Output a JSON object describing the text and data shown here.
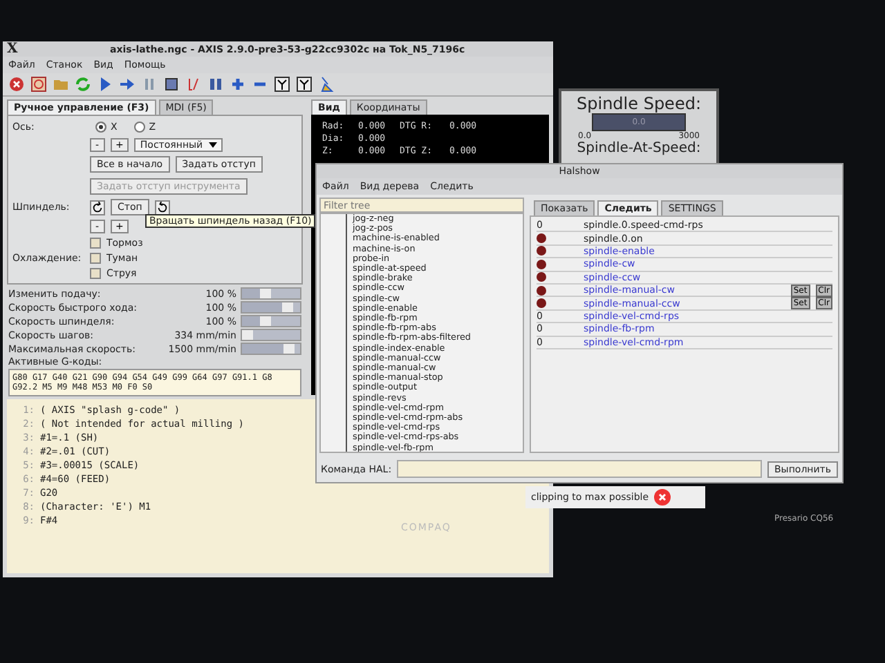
{
  "axis_window": {
    "logo": "X",
    "title": "axis-lathe.ngc - AXIS 2.9.0-pre3-53-g22cc9302c на Tok_N5_7196c",
    "menu": [
      "Файл",
      "Станок",
      "Вид",
      "Помощь"
    ],
    "tabs": [
      {
        "label": "Ручное управление (F3)",
        "selected": true
      },
      {
        "label": "MDI (F5)",
        "selected": false
      }
    ],
    "axis_label": "Ось:",
    "axes": [
      {
        "label": "X",
        "selected": true
      },
      {
        "label": "Z",
        "selected": false
      }
    ],
    "jog_minus": "-",
    "jog_plus": "+",
    "jog_mode": "Постоянный",
    "buttons": [
      {
        "label": "Все в начало",
        "disabled": false
      },
      {
        "label": "Задать отступ",
        "disabled": false
      },
      {
        "label": "Задать отступ инструмента",
        "disabled": true
      }
    ],
    "spindle_label": "Шпиндель:",
    "spindle_stop": "Стоп",
    "spindle_minus": "-",
    "spindle_plus": "+",
    "tooltip": "Вращать шпиндель назад (F10)",
    "brake": {
      "label": "Тормоз",
      "checked": false
    },
    "coolant_label": "Охлаждение:",
    "coolant": [
      {
        "label": "Туман",
        "checked": false
      },
      {
        "label": "Струя",
        "checked": false
      }
    ],
    "overrides": [
      {
        "label": "Изменить подачу:",
        "value": "100 %",
        "level": 0.5
      },
      {
        "label": "Скорость быстрого хода:",
        "value": "100 %",
        "level": 0.88
      },
      {
        "label": "Скорость шпинделя:",
        "value": "100 %",
        "level": 0.5
      },
      {
        "label": "Скорость шагов:",
        "value": "334 mm/min",
        "level": 0.2
      },
      {
        "label": "Максимальная скорость:",
        "value": "1500 mm/min",
        "level": 0.9
      }
    ],
    "gcodes_label": "Активные G-коды:",
    "gcodes": [
      "G80 G17 G40 G21 G90 G94 G54 G49 G99 G64 G97 G91.1 G8",
      "G92.2 M5 M9 M48 M53 M0 F0 S0"
    ],
    "program": [
      {
        "number": "1:",
        "text": "( AXIS \"splash g-code\" )"
      },
      {
        "number": "2:",
        "text": "( Not intended for actual milling )"
      },
      {
        "number": "3:",
        "text": "#1=.1 (SH)"
      },
      {
        "number": "4:",
        "text": "#2=.01 (CUT)"
      },
      {
        "number": "5:",
        "text": "#3=.00015 (SCALE)"
      },
      {
        "number": "6:",
        "text": "#4=60 (FEED)"
      },
      {
        "number": "7:",
        "text": "G20"
      },
      {
        "number": "8:",
        "text": "(Character: 'E') M1"
      },
      {
        "number": "9:",
        "text": "F#4"
      }
    ],
    "preview_tabs": [
      {
        "label": "Вид",
        "selected": true
      },
      {
        "label": "Координаты",
        "selected": false
      }
    ],
    "dro": [
      {
        "label": "Rad:",
        "value": "0.000",
        "dtg_label": "DTG R:",
        "dtg_value": "0.000"
      },
      {
        "label": "Dia:",
        "value": "0.000"
      },
      {
        "label": "Z:",
        "value": "0.000",
        "dtg_label": "DTG Z:",
        "dtg_value": "0.000"
      }
    ]
  },
  "spindle_panel": {
    "title": "Spindle Speed:",
    "reading": "0.0",
    "level": 0,
    "min": "0.0",
    "max": "3000",
    "at_speed": "Spindle-At-Speed:"
  },
  "halshow": {
    "title": "Halshow",
    "menu": [
      "Файл",
      "Вид дерева",
      "Следить"
    ],
    "filter_placeholder": "Filter tree",
    "tree": [
      "jog-z-neg",
      "jog-z-pos",
      "machine-is-enabled",
      "machine-is-on",
      "probe-in",
      "spindle-at-speed",
      "spindle-brake",
      "spindle-ccw",
      "spindle-cw",
      "spindle-enable",
      "spindle-fb-rpm",
      "spindle-fb-rpm-abs",
      "spindle-fb-rpm-abs-filtered",
      "spindle-index-enable",
      "spindle-manual-ccw",
      "spindle-manual-cw",
      "spindle-manual-stop",
      "spindle-output",
      "spindle-revs",
      "spindle-vel-cmd-rpm",
      "spindle-vel-cmd-rpm-abs",
      "spindle-vel-cmd-rps",
      "spindle-vel-cmd-rps-abs",
      "spindle-vel-fb-rpm"
    ],
    "tabs": [
      {
        "label": "Показать",
        "selected": false
      },
      {
        "label": "Следить",
        "selected": true
      },
      {
        "label": "SETTINGS",
        "selected": false
      }
    ],
    "watch": [
      {
        "kind": "number",
        "value": "0",
        "name": "spindle.0.speed-cmd-rps",
        "signal": false
      },
      {
        "kind": "bit",
        "on": false,
        "name": "spindle.0.on",
        "signal": false
      },
      {
        "kind": "bit",
        "on": false,
        "name": "spindle-enable",
        "signal": true
      },
      {
        "kind": "bit",
        "on": false,
        "name": "spindle-cw",
        "signal": true
      },
      {
        "kind": "bit",
        "on": false,
        "name": "spindle-ccw",
        "signal": true
      },
      {
        "kind": "bit",
        "on": false,
        "name": "spindle-manual-cw",
        "signal": true,
        "buttons": [
          "Set",
          "Clr"
        ]
      },
      {
        "kind": "bit",
        "on": false,
        "name": "spindle-manual-ccw",
        "signal": true,
        "buttons": [
          "Set",
          "Clr"
        ]
      },
      {
        "kind": "number",
        "value": "0",
        "name": "spindle-vel-cmd-rps",
        "signal": true
      },
      {
        "kind": "number",
        "value": "0",
        "name": "spindle-fb-rpm",
        "signal": true
      },
      {
        "kind": "number",
        "value": "0",
        "name": "spindle-vel-cmd-rpm",
        "signal": true
      }
    ],
    "command_label": "Команда HAL:",
    "execute": "Выполнить"
  },
  "notification": {
    "text": "clipping to max possible"
  },
  "bezel": {
    "brand": "COMPAQ",
    "model": "Presario CQ56"
  }
}
